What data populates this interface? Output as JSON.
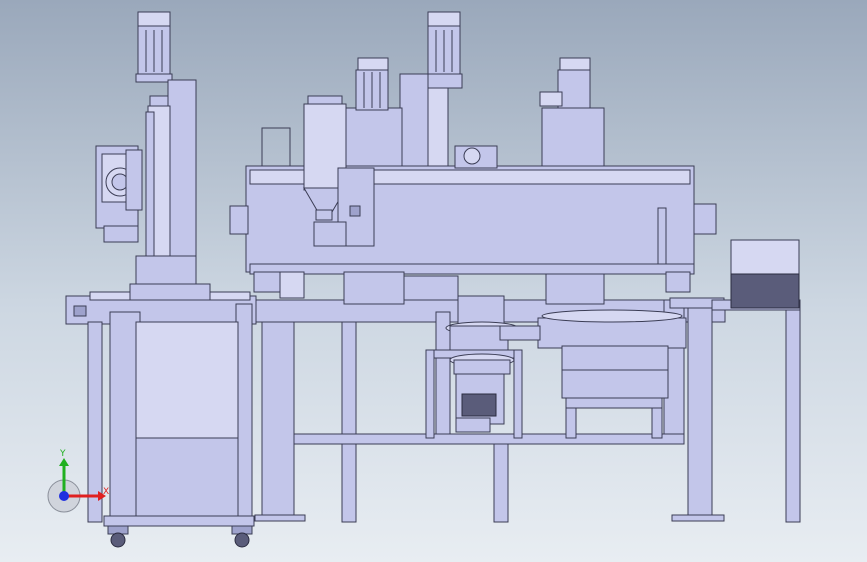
{
  "viewport": {
    "background_top": "#9aa8bb",
    "background_bottom": "#e8edf2",
    "part_color": "#c3c6ea",
    "edge_color": "#3b3d55"
  },
  "triad": {
    "x_label": "X",
    "y_label": "Y",
    "x_color": "#e02020",
    "y_color": "#20b020",
    "z_color": "#2030e0"
  }
}
